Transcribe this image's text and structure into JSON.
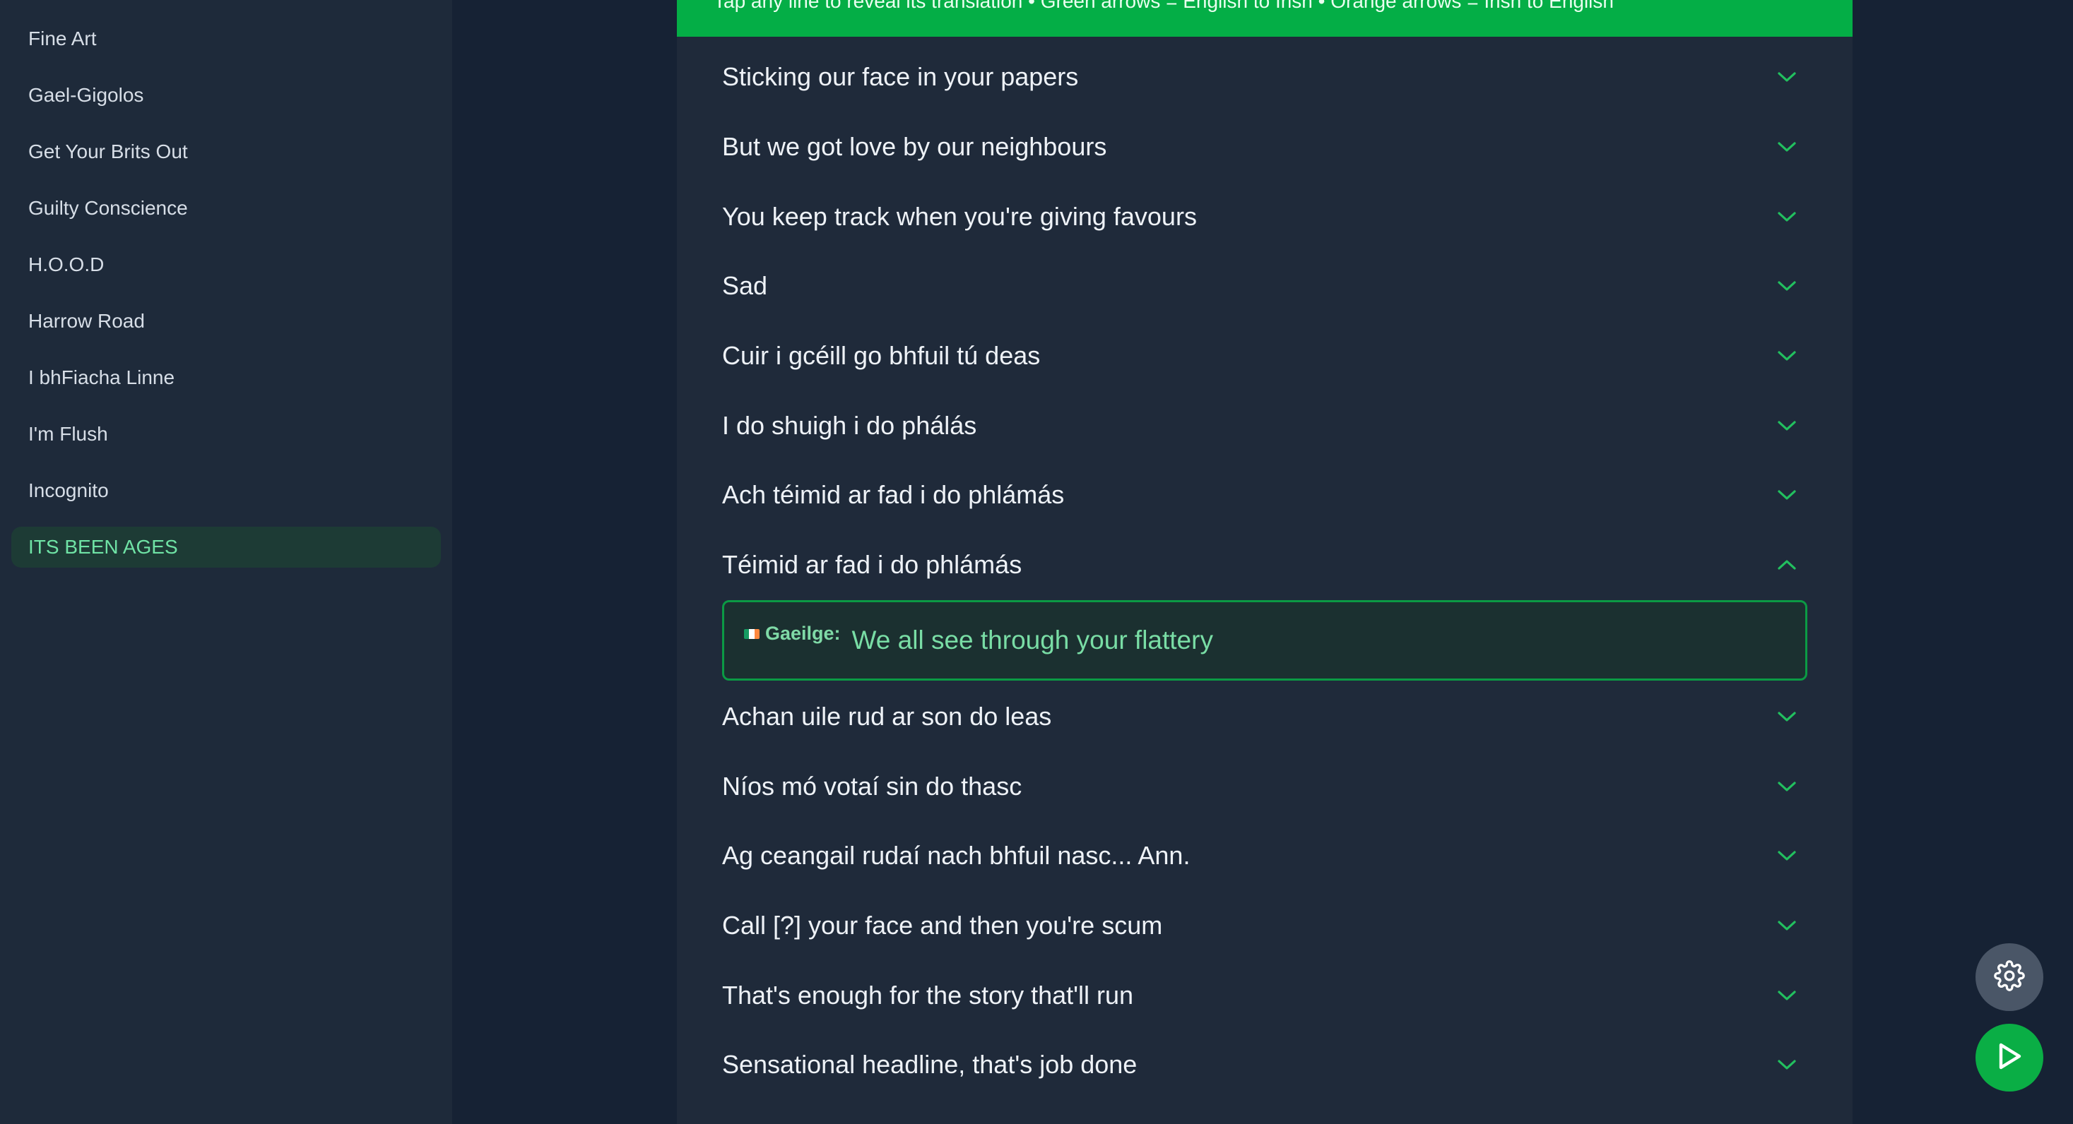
{
  "sidebar": {
    "items": [
      {
        "label": "Fine Art"
      },
      {
        "label": "Gael-Gigolos"
      },
      {
        "label": "Get Your Brits Out"
      },
      {
        "label": "Guilty Conscience"
      },
      {
        "label": "H.O.O.D"
      },
      {
        "label": "Harrow Road"
      },
      {
        "label": "I bhFiacha Linne"
      },
      {
        "label": "I'm Flush"
      },
      {
        "label": "Incognito"
      },
      {
        "label": "ITS BEEN AGES",
        "active": true
      }
    ]
  },
  "banner": {
    "text": "Tap any line to reveal its translation • Green arrows = English to Irish • Orange arrows = Irish to English"
  },
  "lyrics": [
    {
      "text": "Sticking our face in your papers"
    },
    {
      "text": "But we got love by our neighbours"
    },
    {
      "text": "You keep track when you're giving favours"
    },
    {
      "text": "Sad"
    },
    {
      "text": "Cuir i gcéill go bhfuil tú deas"
    },
    {
      "text": "I do shuigh i do phálás"
    },
    {
      "text": "Ach téimid ar fad i do phlámás"
    },
    {
      "text": "Téimid ar fad i do phlámás",
      "expanded": true
    },
    {
      "text": "Achan uile rud ar son do leas"
    },
    {
      "text": "Níos mó votaí sin do thasc"
    },
    {
      "text": "Ag ceangail rudaí nach bhfuil nasc... Ann."
    },
    {
      "text": "Call [?] your face and then you're scum"
    },
    {
      "text": "That's enough for the story that'll run"
    },
    {
      "text": "Sensational headline, that's job done"
    }
  ],
  "translation": {
    "label": "Gaeilge:",
    "text": "We all see through your flattery",
    "flag_icon": "irish-flag-icon",
    "flag_colors": [
      "#169b62",
      "#ffffff",
      "#ff883e"
    ]
  },
  "icons": {
    "collapsed": "chevron-down-icon",
    "expanded": "chevron-up-icon",
    "settings": "gear-icon",
    "play": "play-icon"
  },
  "colors": {
    "accent": "#04ae46",
    "chevron": "#22c05f",
    "active_text": "#6fe3a5"
  }
}
